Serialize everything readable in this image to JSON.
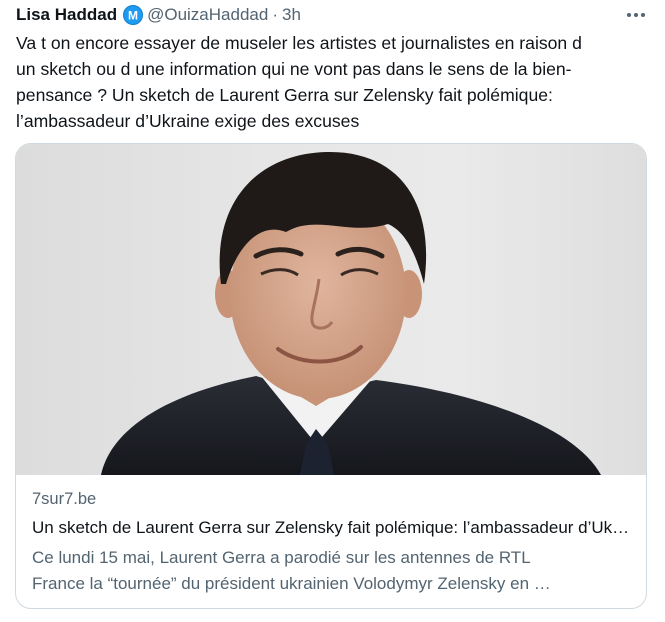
{
  "author": {
    "name": "Lisa Haddad",
    "badge_letter": "M",
    "handle": "@OuizaHaddad",
    "separator": "·",
    "time": "3h"
  },
  "menu_icon": "more-horizontal-icon",
  "tweet": {
    "text": "Va t on encore essayer de museler les artistes et journalistes en raison d\nun sketch ou d une information qui ne vont pas dans le sens de la bien-\npensance ? Un sketch de Laurent Gerra sur Zelensky fait polémique:\nl’ambassadeur d’Ukraine exige des excuses"
  },
  "card": {
    "domain": "7sur7.be",
    "title": "Un sketch de Laurent Gerra sur Zelensky fait polémique: l’ambassadeur d’Ukraine exige des excuses",
    "description": "Ce lundi 15 mai, Laurent Gerra a parodié sur les antennes de RTL\nFrance la “tournée” du président ukrainien Volodymyr Zelensky en …"
  },
  "colors": {
    "text": "#0f1419",
    "secondary": "#536471",
    "badge": "#1d9bf0",
    "border": "#cfd9de"
  }
}
